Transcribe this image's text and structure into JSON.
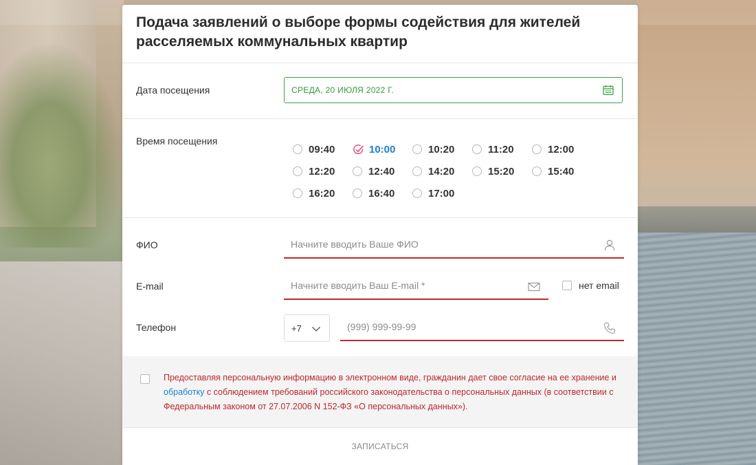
{
  "form": {
    "title": "Подача заявлений о выборе формы содействия для жителей расселяемых коммунальных квартир",
    "date": {
      "label": "Дата посещения",
      "value": "СРЕДА, 20 ИЮЛЯ 2022 Г.",
      "icon": "calendar-icon"
    },
    "time": {
      "label": "Время посещения",
      "selected": "10:00",
      "slots": [
        "09:40",
        "10:00",
        "10:20",
        "11:20",
        "12:00",
        "12:20",
        "12:40",
        "14:20",
        "15:20",
        "15:40",
        "16:20",
        "16:40",
        "17:00"
      ]
    },
    "fio": {
      "label": "ФИО",
      "placeholder": "Начните вводить Ваше ФИО",
      "icon": "user-icon"
    },
    "email": {
      "label": "E-mail",
      "placeholder": "Начните вводить Ваш E-mail *",
      "icon": "envelope-icon",
      "no_email_label": "нет email"
    },
    "phone": {
      "label": "Телефон",
      "country_code": "+7",
      "placeholder": "(999) 999-99-99",
      "icon": "phone-icon"
    },
    "consent": {
      "text_before": "Предоставляя персональную информацию в электронном виде, гражданин дает свое согласие на ее хранение и ",
      "link_text": "обработку",
      "text_after": " с соблюдением требований российского законодательства о персональных данных (в соответствии с Федеральным законом от 27.07.2006 N 152-ФЗ «О персональных данных»)."
    },
    "submit_label": "ЗАПИСАТЬСЯ"
  },
  "colors": {
    "accent_green": "#3aa542",
    "error_red": "#c4262b",
    "link_blue": "#1a7fd4"
  }
}
